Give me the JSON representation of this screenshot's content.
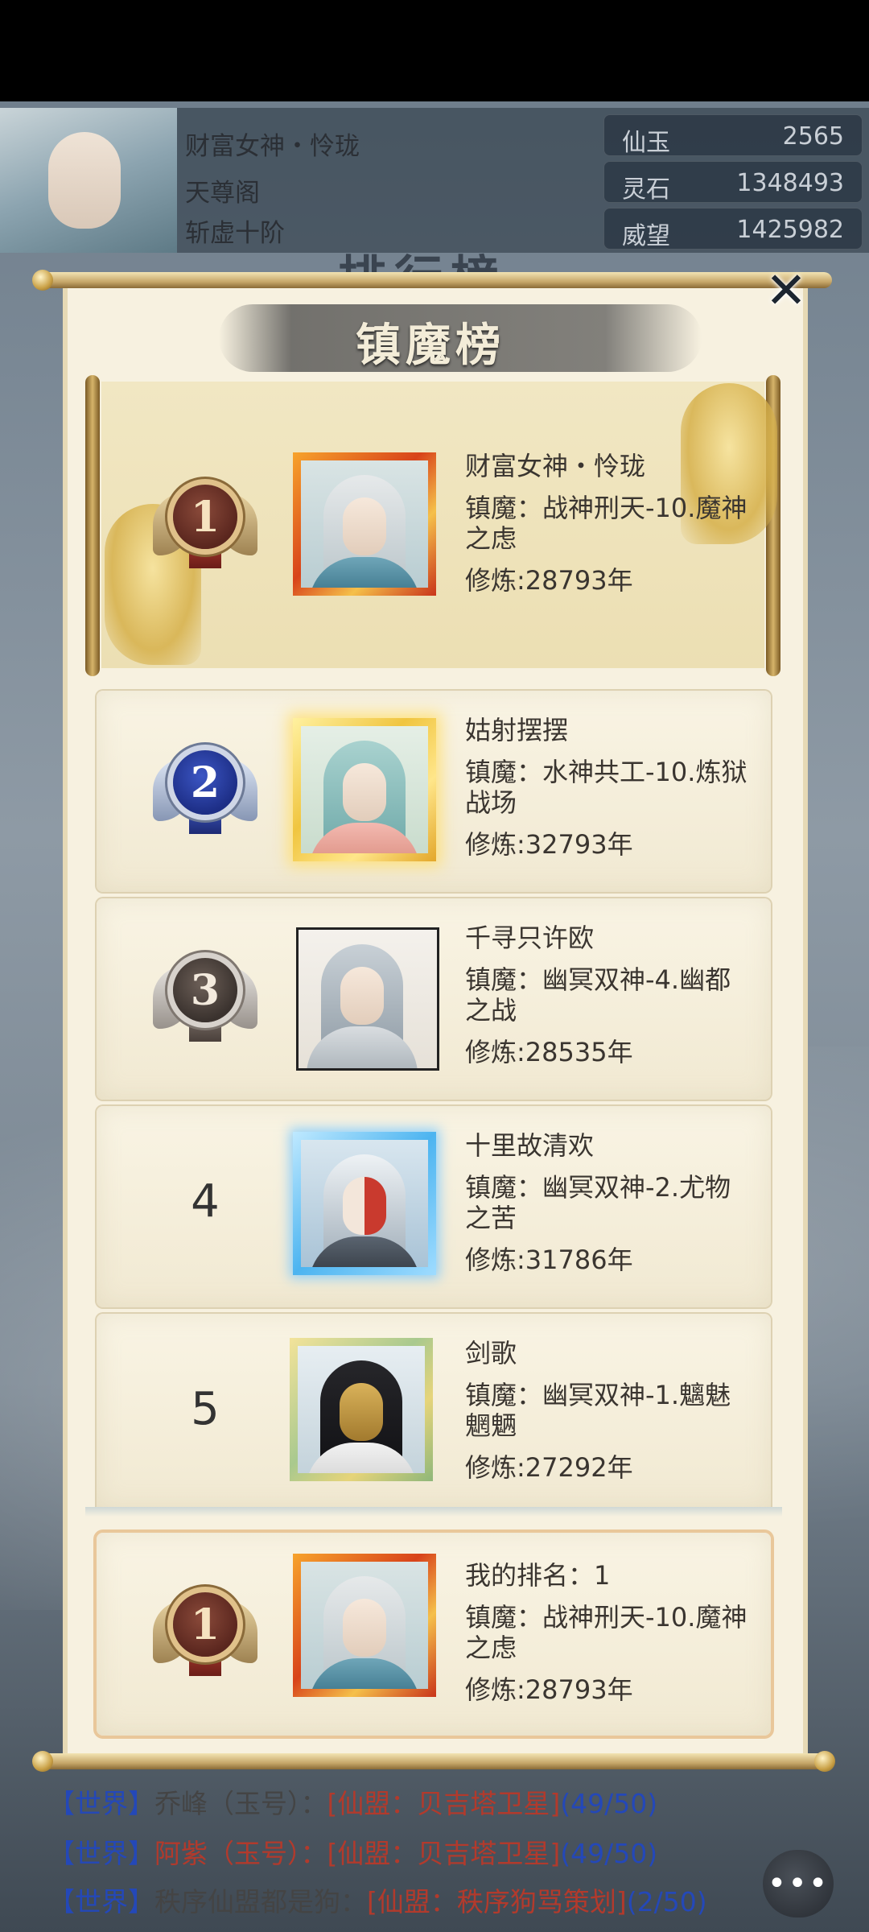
{
  "header": {
    "player_name": "财富女神・怜珑",
    "sect": "天尊阁",
    "realm": "斩虚十阶",
    "resources": [
      {
        "name": "仙玉",
        "value": "2565"
      },
      {
        "name": "灵石",
        "value": "1348493"
      },
      {
        "name": "威望",
        "value": "1425982"
      }
    ],
    "background_title": "排行榜"
  },
  "dialog": {
    "title": "镇魔榜",
    "close_icon": "close-icon"
  },
  "rankings": [
    {
      "rank": "1",
      "name": "财富女神・怜珑",
      "stage": "镇魔：战神刑天-10.魔神之虑",
      "cultivation": "修炼:28793年",
      "badge": "gold",
      "frame": "fire"
    },
    {
      "rank": "2",
      "name": "姑射摆摆",
      "stage": "镇魔：水神共工-10.炼狱战场",
      "cultivation": "修炼:32793年",
      "badge": "silver",
      "frame": "goldglow"
    },
    {
      "rank": "3",
      "name": "千寻只许欧",
      "stage": "镇魔：幽冥双神-4.幽都之战",
      "cultivation": "修炼:28535年",
      "badge": "bronze",
      "frame": "plain"
    },
    {
      "rank": "4",
      "name": "十里故清欢",
      "stage": "镇魔：幽冥双神-2.尤物之苦",
      "cultivation": "修炼:31786年",
      "badge": "none",
      "frame": "ice"
    },
    {
      "rank": "5",
      "name": "剑歌",
      "stage": "镇魔：幽冥双神-1.魑魅魍魉",
      "cultivation": "修炼:27292年",
      "badge": "none",
      "frame": "jade"
    }
  ],
  "my_rank": {
    "rank": "1",
    "label": "我的排名：1",
    "stage": "镇魔：战神刑天-10.魔神之虑",
    "cultivation": "修炼:28793年"
  },
  "chat": [
    {
      "channel": "【世界】",
      "who": "乔峰（玉号）：",
      "alliance": "[仙盟：贝吉塔卫星]",
      "count": "(49/50)"
    },
    {
      "channel": "【世界】",
      "who": "阿紫（玉号）：",
      "alliance": "[仙盟：贝吉塔卫星]",
      "count": "(49/50)"
    },
    {
      "channel": "【世界】",
      "who": "秩序仙盟都是狗：",
      "alliance": "[仙盟：秩序狗骂策划]",
      "count": "(2/50)"
    }
  ],
  "chat_button_label": "•••"
}
